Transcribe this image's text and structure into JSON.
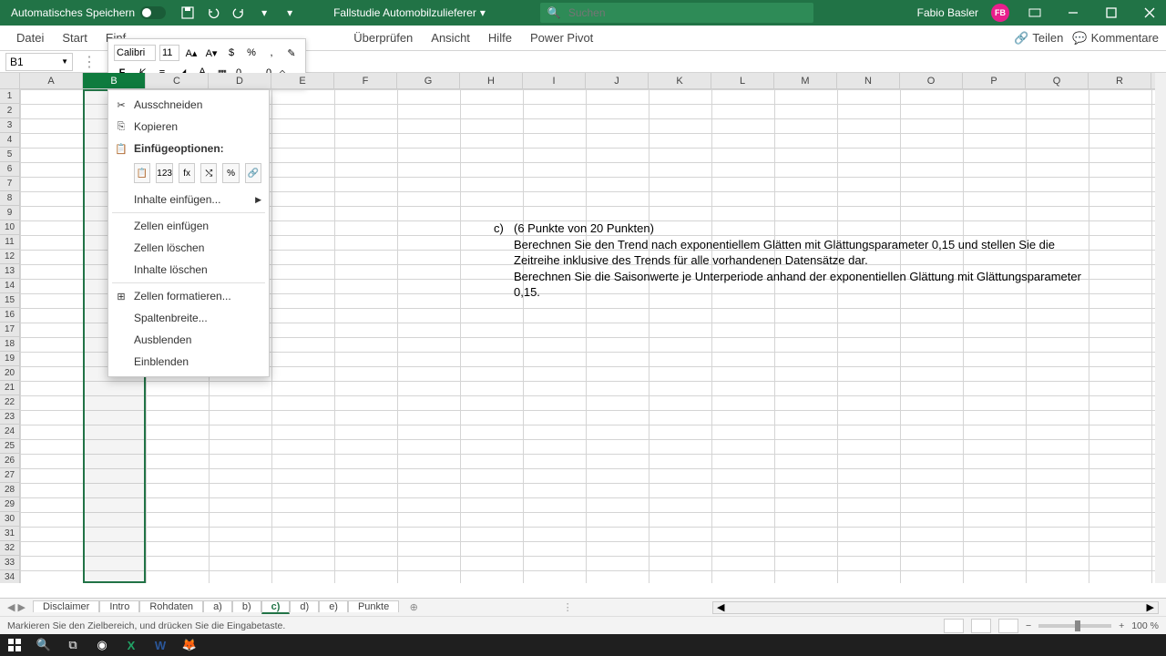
{
  "titlebar": {
    "autosave": "Automatisches Speichern",
    "doc_title": "Fallstudie Automobilzulieferer",
    "search_placeholder": "Suchen",
    "user_name": "Fabio Basler",
    "user_initials": "FB"
  },
  "ribbon": {
    "tabs": [
      "Datei",
      "Start",
      "Einf",
      "Überprüfen",
      "Ansicht",
      "Hilfe",
      "Power Pivot"
    ],
    "share": "Teilen",
    "comments": "Kommentare"
  },
  "mini_toolbar": {
    "font": "Calibri",
    "size": "11"
  },
  "name_box": "B1",
  "columns": [
    "A",
    "B",
    "C",
    "D",
    "E",
    "F",
    "G",
    "H",
    "I",
    "J",
    "K",
    "L",
    "M",
    "N",
    "O",
    "P",
    "Q",
    "R"
  ],
  "context_menu": {
    "cut": "Ausschneiden",
    "copy": "Kopieren",
    "paste_header": "Einfügeoptionen:",
    "insert_contents": "Inhalte einfügen...",
    "insert_cells": "Zellen einfügen",
    "delete_cells": "Zellen löschen",
    "clear_contents": "Inhalte löschen",
    "format_cells": "Zellen formatieren...",
    "col_width": "Spaltenbreite...",
    "hide": "Ausblenden",
    "unhide": "Einblenden"
  },
  "sheet_content": {
    "label": "c)",
    "heading": "(6 Punkte von 20 Punkten)",
    "line1": "Berechnen Sie den Trend nach exponentiellem Glätten mit Glättungsparameter 0,15 und stellen Sie die Zeitreihe inklusive des Trends für alle vorhandenen Datensätze dar.",
    "line2": "Berechnen Sie die Saisonwerte je Unterperiode anhand der exponentiellen Glättung mit Glättungsparameter 0,15."
  },
  "sheet_tabs": [
    "Disclaimer",
    "Intro",
    "Rohdaten",
    "a)",
    "b)",
    "c)",
    "d)",
    "e)",
    "Punkte"
  ],
  "active_sheet": "c)",
  "status_text": "Markieren Sie den Zielbereich, und drücken Sie die Eingabetaste.",
  "zoom": "100 %",
  "row_count": 34
}
